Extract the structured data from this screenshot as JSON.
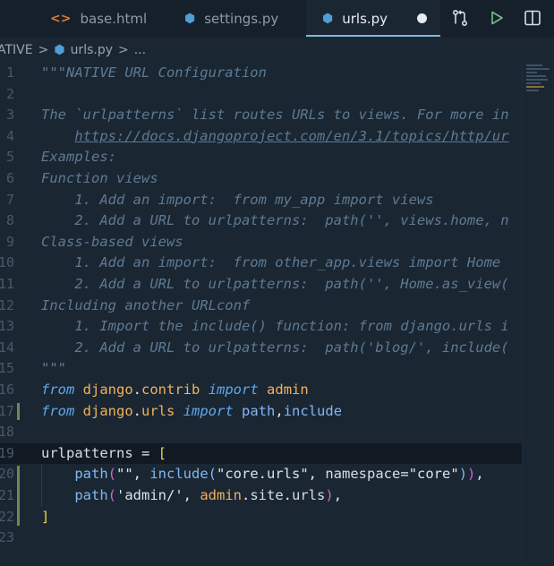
{
  "tabs": [
    {
      "label": "base.html",
      "icon": "<>"
    },
    {
      "label": "settings.py",
      "icon": "⬢"
    },
    {
      "label": "urls.py",
      "icon": "⬢"
    }
  ],
  "breadcrumb": {
    "folder": "ATIVE",
    "sep1": ">",
    "file": "urls.py",
    "sep2": ">",
    "more": "..."
  },
  "lines": [
    {
      "n": "1",
      "spans": [
        {
          "c": "c",
          "t": "\"\"\"NATIVE URL Configuration"
        }
      ]
    },
    {
      "n": "2",
      "spans": []
    },
    {
      "n": "3",
      "spans": [
        {
          "c": "c",
          "t": "The `urlpatterns` list routes URLs to views. For more in"
        }
      ]
    },
    {
      "n": "4",
      "spans": [
        {
          "c": "c",
          "t": "    "
        },
        {
          "c": "c u",
          "t": "https://docs.djangoproject.com/en/3.1/topics/http/ur"
        }
      ]
    },
    {
      "n": "5",
      "spans": [
        {
          "c": "c",
          "t": "Examples:"
        }
      ]
    },
    {
      "n": "6",
      "spans": [
        {
          "c": "c",
          "t": "Function views"
        }
      ]
    },
    {
      "n": "7",
      "spans": [
        {
          "c": "c",
          "t": "    1. Add an import:  from my_app import views"
        }
      ]
    },
    {
      "n": "8",
      "spans": [
        {
          "c": "c",
          "t": "    2. Add a URL to urlpatterns:  path('', views.home, n"
        }
      ]
    },
    {
      "n": "9",
      "spans": [
        {
          "c": "c",
          "t": "Class-based views"
        }
      ]
    },
    {
      "n": "10",
      "spans": [
        {
          "c": "c",
          "t": "    1. Add an import:  from other_app.views import Home"
        }
      ]
    },
    {
      "n": "11",
      "spans": [
        {
          "c": "c",
          "t": "    2. Add a URL to urlpatterns:  path('', Home.as_view("
        }
      ]
    },
    {
      "n": "12",
      "spans": [
        {
          "c": "c",
          "t": "Including another URLconf"
        }
      ]
    },
    {
      "n": "13",
      "spans": [
        {
          "c": "c",
          "t": "    1. Import the include() function: from django.urls i"
        }
      ]
    },
    {
      "n": "14",
      "spans": [
        {
          "c": "c",
          "t": "    2. Add a URL to urlpatterns:  path('blog/', include("
        }
      ]
    },
    {
      "n": "15",
      "spans": [
        {
          "c": "c",
          "t": "\"\"\""
        }
      ]
    },
    {
      "n": "16",
      "spans": [
        {
          "c": "kw",
          "t": "from"
        },
        {
          "c": "id",
          "t": " "
        },
        {
          "c": "mod",
          "t": "django"
        },
        {
          "c": "op",
          "t": "."
        },
        {
          "c": "mod",
          "t": "contrib"
        },
        {
          "c": "id",
          "t": " "
        },
        {
          "c": "kw",
          "t": "import"
        },
        {
          "c": "id",
          "t": " "
        },
        {
          "c": "mod",
          "t": "admin"
        }
      ]
    },
    {
      "n": "17",
      "spans": [
        {
          "c": "kw",
          "t": "from"
        },
        {
          "c": "id",
          "t": " "
        },
        {
          "c": "mod",
          "t": "django"
        },
        {
          "c": "op",
          "t": "."
        },
        {
          "c": "mod",
          "t": "urls"
        },
        {
          "c": "id",
          "t": " "
        },
        {
          "c": "kw",
          "t": "import"
        },
        {
          "c": "id",
          "t": " "
        },
        {
          "c": "fn",
          "t": "path"
        },
        {
          "c": "op",
          "t": ","
        },
        {
          "c": "fn",
          "t": "include"
        }
      ]
    },
    {
      "n": "18",
      "spans": []
    },
    {
      "n": "19",
      "spans": [
        {
          "c": "id",
          "t": "urlpatterns"
        },
        {
          "c": "op",
          "t": " = "
        },
        {
          "c": "br1",
          "t": "["
        }
      ]
    },
    {
      "n": "20",
      "spans": [
        {
          "c": "id",
          "t": "    "
        },
        {
          "c": "fn",
          "t": "path"
        },
        {
          "c": "br2",
          "t": "("
        },
        {
          "c": "str",
          "t": "\"\""
        },
        {
          "c": "op",
          "t": ", "
        },
        {
          "c": "fn",
          "t": "include"
        },
        {
          "c": "fn",
          "t": "("
        },
        {
          "c": "str",
          "t": "\"core.urls\""
        },
        {
          "c": "op",
          "t": ", "
        },
        {
          "c": "id",
          "t": "namespace"
        },
        {
          "c": "op",
          "t": "="
        },
        {
          "c": "str",
          "t": "\"core\""
        },
        {
          "c": "fn",
          "t": ")"
        },
        {
          "c": "br2",
          "t": ")"
        },
        {
          "c": "op",
          "t": ","
        }
      ]
    },
    {
      "n": "21",
      "spans": [
        {
          "c": "id",
          "t": "    "
        },
        {
          "c": "fn",
          "t": "path"
        },
        {
          "c": "br2",
          "t": "("
        },
        {
          "c": "str",
          "t": "'admin/'"
        },
        {
          "c": "op",
          "t": ", "
        },
        {
          "c": "mod",
          "t": "admin"
        },
        {
          "c": "op",
          "t": "."
        },
        {
          "c": "id",
          "t": "site"
        },
        {
          "c": "op",
          "t": "."
        },
        {
          "c": "id",
          "t": "urls"
        },
        {
          "c": "br2",
          "t": ")"
        },
        {
          "c": "op",
          "t": ","
        }
      ]
    },
    {
      "n": "22",
      "spans": [
        {
          "c": "br1",
          "t": "]"
        }
      ]
    },
    {
      "n": "23",
      "spans": []
    }
  ]
}
